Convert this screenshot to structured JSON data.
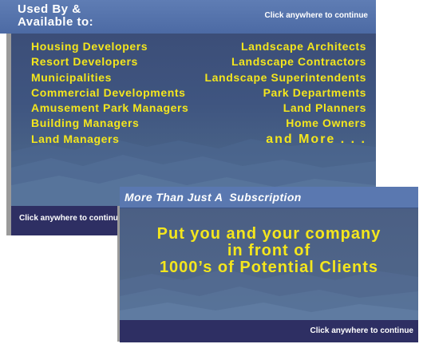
{
  "card1": {
    "title": "Used By &\nAvailable to:",
    "header_hint": "Click anywhere to continue",
    "footer_hint": "Click anywhere to continue",
    "left_list": [
      "Housing Developers",
      "Resort Developers",
      "Municipalities",
      "Commercial Developments",
      "Amusement Park Managers",
      "Building Managers",
      "Land Managers"
    ],
    "right_list": [
      "Landscape Architects",
      "Landscape Contractors",
      "Landscape Superintendents",
      "Park Departments",
      "Land Planners",
      "Home Owners",
      "and More . . ."
    ]
  },
  "card2": {
    "title": "More Than Just A  Subscription",
    "message": [
      "Put you and your company",
      "in front of",
      "1000’s of Potential Clients"
    ],
    "footer_hint": "Click anywhere to continue"
  },
  "colors": {
    "accent_text": "#f4e61d",
    "header_blue": "#5a78b0",
    "footer_navy": "#2e2f63",
    "body_slate": "#3f5580"
  }
}
